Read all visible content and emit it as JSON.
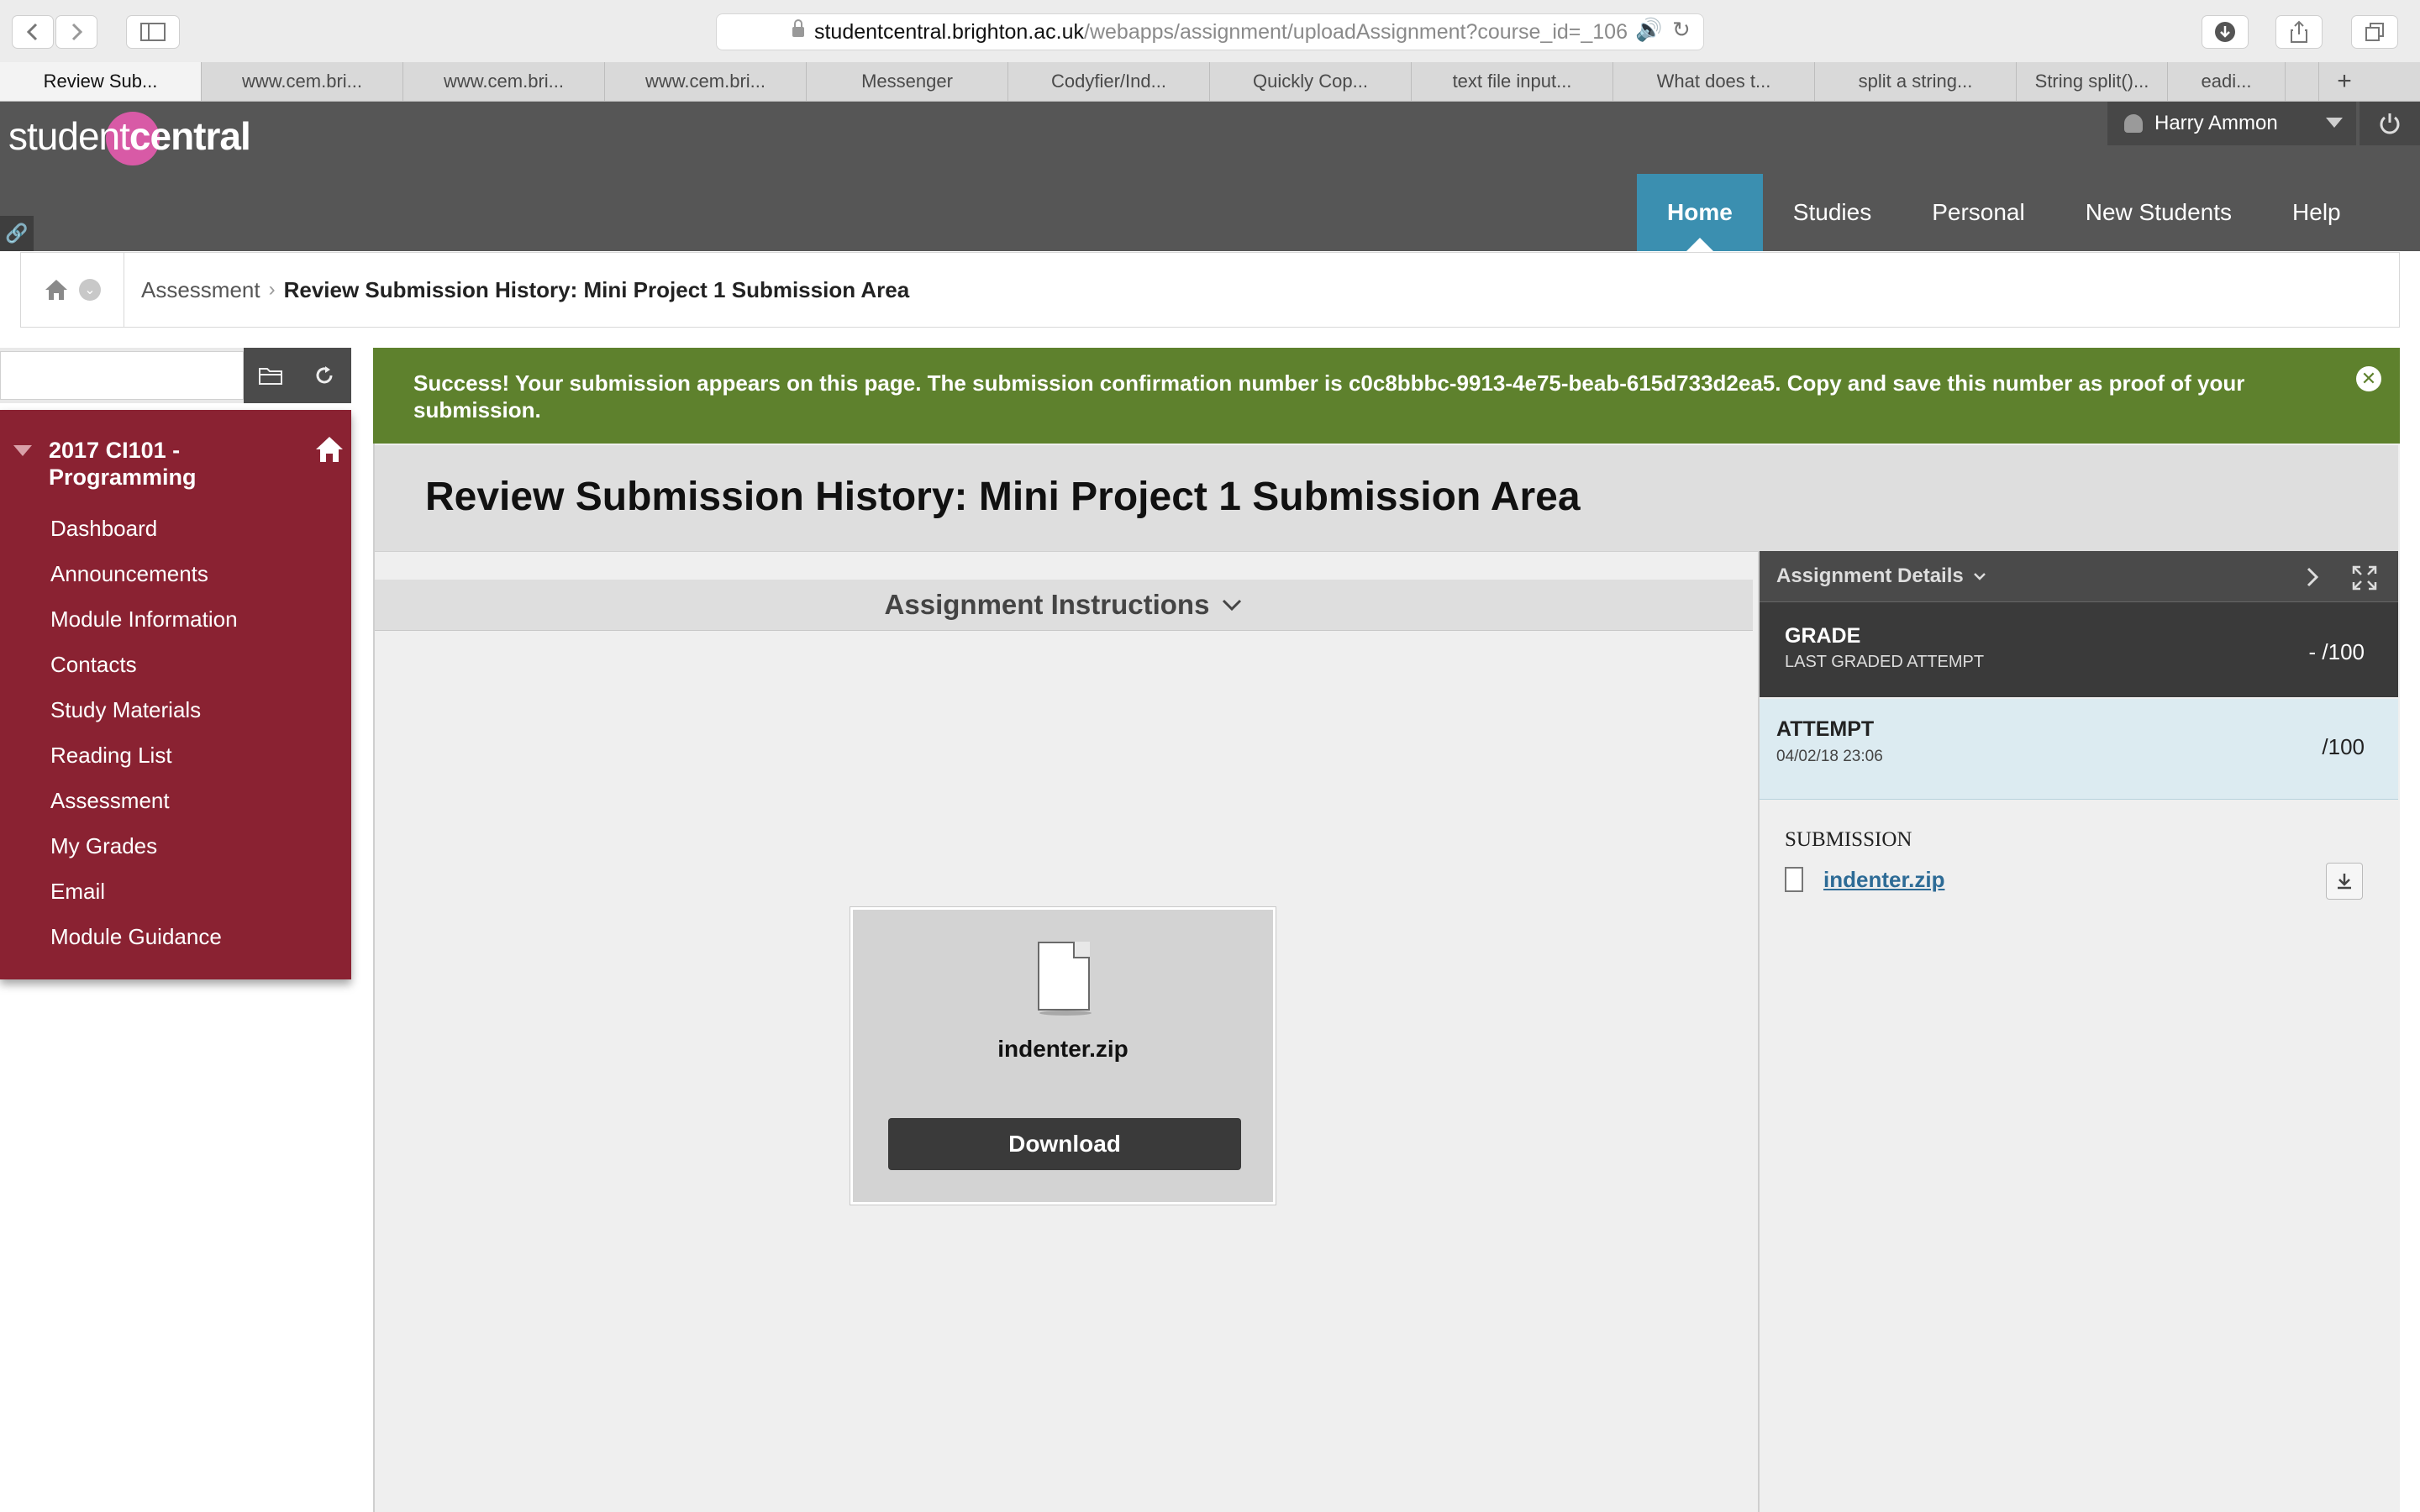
{
  "browser": {
    "url_host": "studentcentral.brighton.ac.uk",
    "url_path": "/webapps/assignment/uploadAssignment?course_id=_106",
    "tabs": [
      "Review Sub...",
      "www.cem.bri...",
      "www.cem.bri...",
      "www.cem.bri...",
      "Messenger",
      "Codyfier/Ind...",
      "Quickly Cop...",
      "text file input...",
      "What does t...",
      "split a string...",
      "String split()...",
      "eadi..."
    ],
    "new_tab_symbol": "+"
  },
  "header": {
    "logo_part1": "student",
    "logo_part2": "central",
    "user_name": "Harry Ammon",
    "nav": [
      "Home",
      "Studies",
      "Personal",
      "New Students",
      "Help"
    ]
  },
  "breadcrumb": {
    "parent": "Assessment",
    "current": "Review Submission History: Mini Project 1 Submission Area"
  },
  "course_menu": {
    "course_title": "2017 CI101 - Programming",
    "items": [
      "Dashboard",
      "Announcements",
      "Module Information",
      "Contacts",
      "Study Materials",
      "Reading List",
      "Assessment",
      "My Grades",
      "Email",
      "Module Guidance"
    ]
  },
  "success_message": "Success! Your submission appears on this page. The submission confirmation number is c0c8bbbc-9913-4e75-beab-615d733d2ea5. Copy and save this number as proof of your submission.",
  "page": {
    "title": "Review Submission History: Mini Project 1 Submission Area",
    "instructions_label": "Assignment Instructions"
  },
  "preview": {
    "file_name": "indenter.zip",
    "download_label": "Download"
  },
  "details": {
    "header": "Assignment Details",
    "grade_label": "GRADE",
    "grade_sub": "LAST GRADED ATTEMPT",
    "grade_value": "- /100",
    "attempt_label": "ATTEMPT",
    "attempt_date": "04/02/18 23:06",
    "attempt_value": "/100",
    "submission_label": "SUBMISSION",
    "submission_file": "indenter.zip"
  },
  "colors": {
    "header_bg": "#565656",
    "nav_active": "#3b8fb0",
    "course_menu": "#8a2232",
    "success": "#5e812d",
    "logo_dot": "#d85aa6"
  }
}
